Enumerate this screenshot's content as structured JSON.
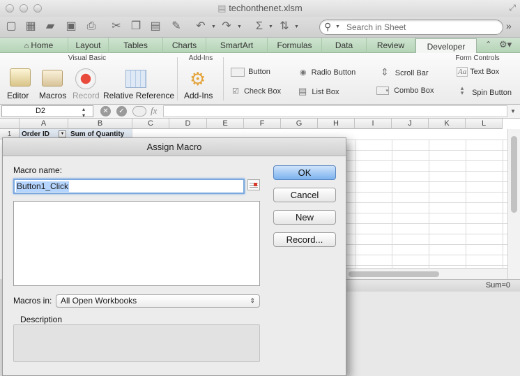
{
  "window": {
    "title": "techonthenet.xlsm"
  },
  "toolbar": {
    "search_placeholder": "Search in Sheet"
  },
  "ribbon": {
    "tabs": [
      "Home",
      "Layout",
      "Tables",
      "Charts",
      "SmartArt",
      "Formulas",
      "Data",
      "Review",
      "Developer"
    ],
    "active_tab": "Developer",
    "groups": {
      "visual_basic": {
        "title": "Visual Basic",
        "editor": "Editor",
        "macros": "Macros",
        "record": "Record",
        "relative_reference": "Relative Reference"
      },
      "add_ins": {
        "title": "Add-Ins",
        "add_ins": "Add-Ins"
      },
      "form_controls": {
        "title": "Form Controls",
        "button": "Button",
        "radio_button": "Radio Button",
        "scroll_bar": "Scroll Bar",
        "text_box": "Text Box",
        "check_box": "Check Box",
        "list_box": "List Box",
        "combo_box": "Combo Box",
        "spin_button": "Spin Button"
      }
    }
  },
  "formula_bar": {
    "name_box": "D2",
    "fx": "fx"
  },
  "sheet": {
    "columns": [
      "A",
      "B",
      "C",
      "D",
      "E",
      "F",
      "G",
      "H",
      "I",
      "J",
      "K",
      "L"
    ],
    "row1_label": "1",
    "a1": "Order ID",
    "b1": "Sum of Quantity"
  },
  "status_bar": {
    "sum": "Sum=0"
  },
  "dialog": {
    "title": "Assign Macro",
    "macro_name_label": "Macro name:",
    "macro_name_value": "Button1_Click",
    "macros_in_label": "Macros in:",
    "macros_in_value": "All Open Workbooks",
    "description_label": "Description",
    "buttons": {
      "ok": "OK",
      "cancel": "Cancel",
      "new": "New",
      "record": "Record..."
    }
  }
}
